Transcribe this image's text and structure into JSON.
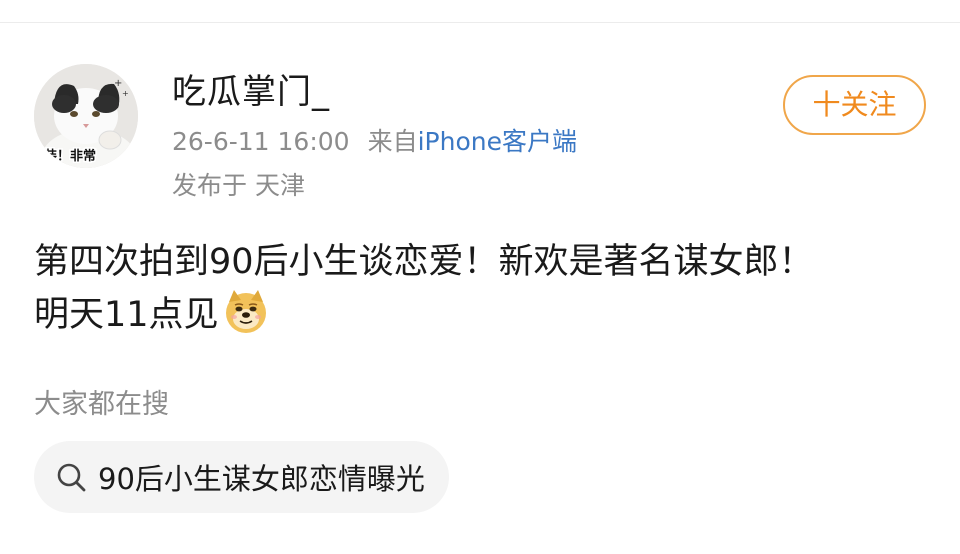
{
  "user": {
    "name": "吃瓜掌门_",
    "avatar_caption": "装！非常"
  },
  "meta": {
    "time": "26-6-11 16:00",
    "from": "来自",
    "client": "iPhone客户端",
    "location": "发布于 天津"
  },
  "follow_button": {
    "label": "十关注"
  },
  "post": {
    "line1": "第四次拍到90后小生谈恋爱！新欢是著名谋女郎！",
    "line2": "明天11点见",
    "emoji": "doge-emoji"
  },
  "trending": {
    "title": "大家都在搜",
    "search_chip": {
      "icon": "search-icon",
      "label": "90后小生谋女郎恋情曝光"
    }
  }
}
